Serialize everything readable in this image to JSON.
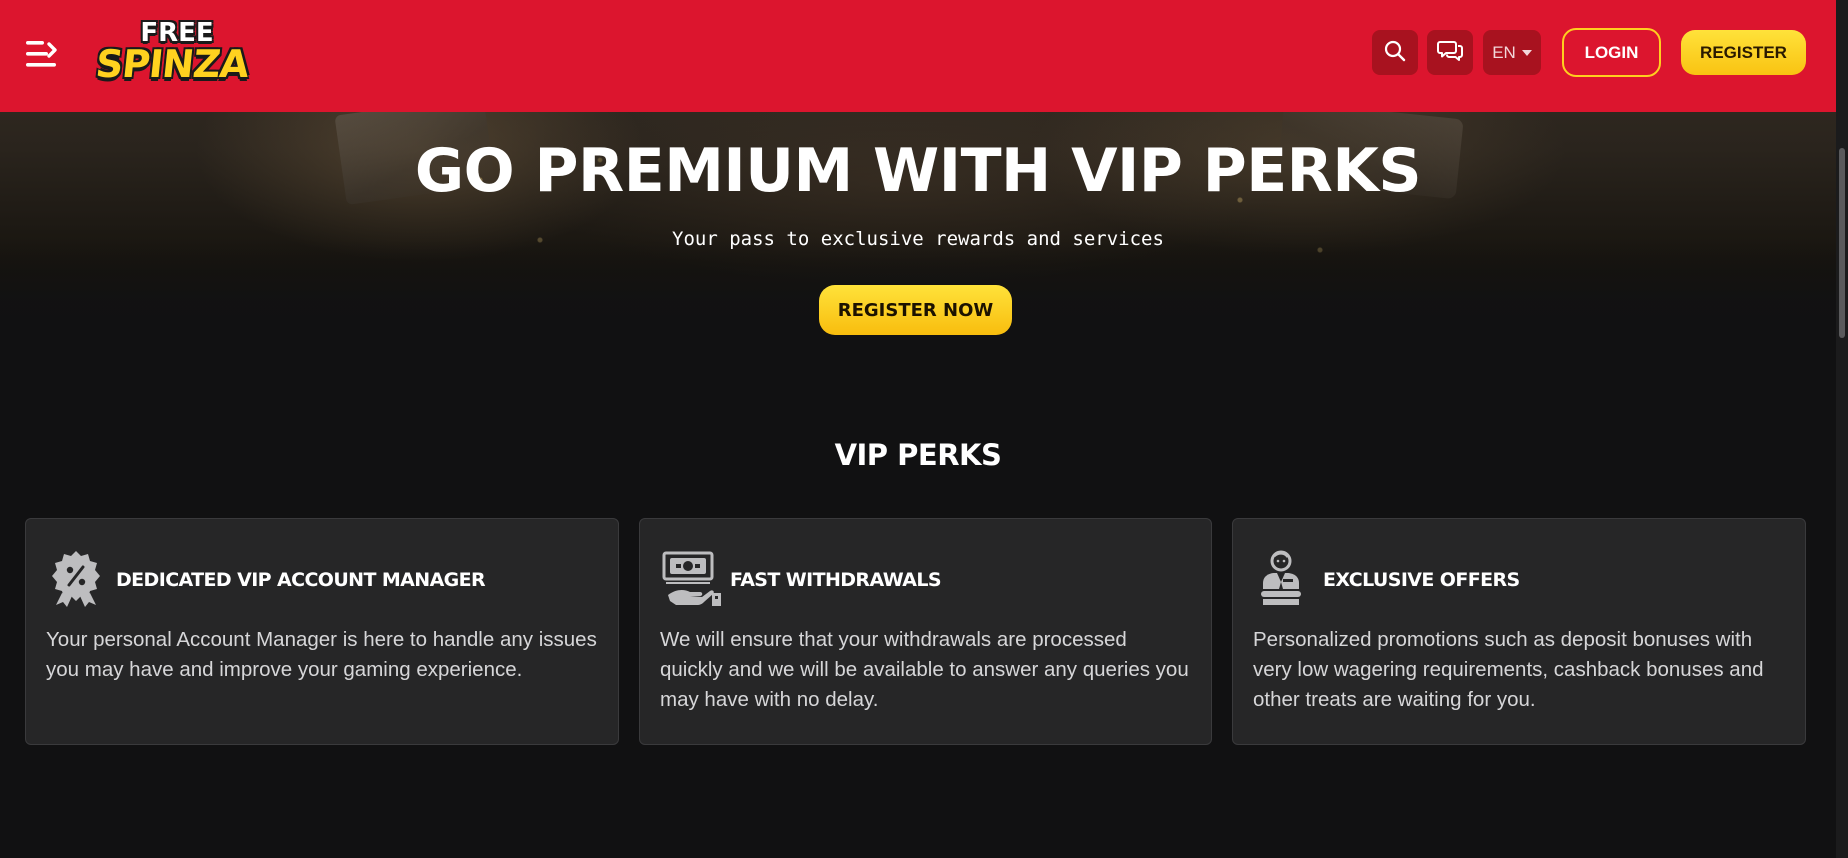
{
  "header": {
    "logo_top": "FREE",
    "logo_bottom": "SPINZA",
    "language": "EN",
    "login_label": "LOGIN",
    "register_label": "REGISTER"
  },
  "hero": {
    "title": "GO PREMIUM WITH VIP PERKS",
    "subtitle": "Your pass to exclusive rewards and services",
    "cta_label": "REGISTER NOW"
  },
  "perks": {
    "title": "VIP PERKS",
    "items": [
      {
        "icon": "percent-badge-icon",
        "title": "DEDICATED VIP ACCOUNT MANAGER",
        "text": "Your personal Account Manager is here to handle any issues you may have and improve your gaming experience."
      },
      {
        "icon": "cash-hand-icon",
        "title": "FAST WITHDRAWALS",
        "text": "We will ensure that your withdrawals are processed quickly and we will be available to answer any queries you may have with no delay."
      },
      {
        "icon": "businessman-icon",
        "title": "EXCLUSIVE OFFERS",
        "text": "Personalized promotions such as deposit bonuses with very low wagering requirements, cashback bonuses and other treats are waiting for you."
      }
    ]
  },
  "colors": {
    "header_red": "#dc152e",
    "accent_yellow": "#ffd21f",
    "background": "#111112",
    "card": "#262627"
  }
}
